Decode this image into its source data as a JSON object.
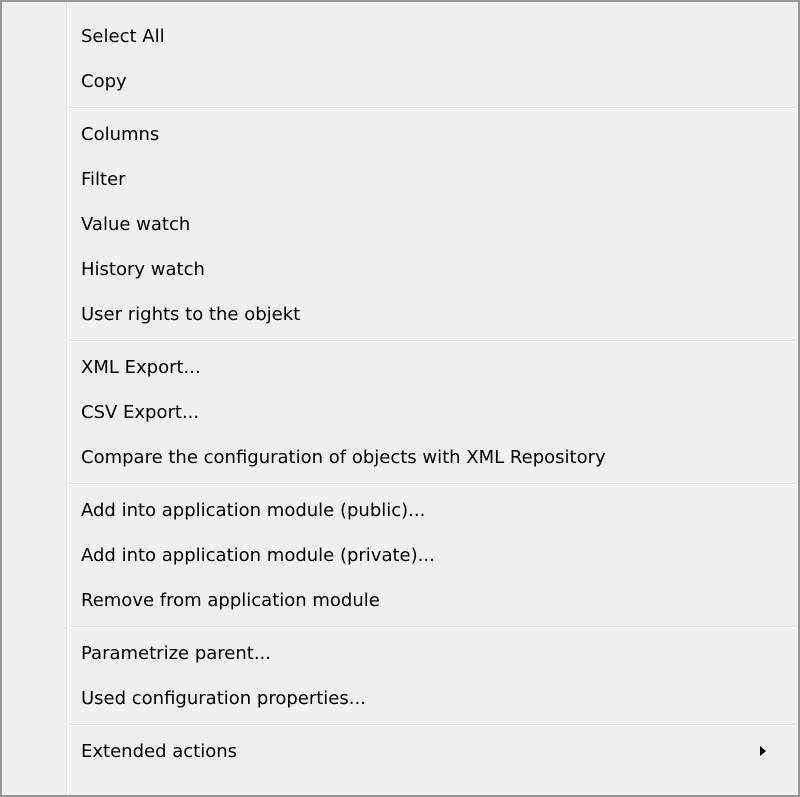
{
  "menu": {
    "groups": [
      [
        "Select All",
        "Copy"
      ],
      [
        "Columns",
        "Filter",
        "Value watch",
        "History watch",
        "User rights to the objekt"
      ],
      [
        "XML Export...",
        "CSV Export...",
        "Compare the configuration of objects with XML Repository"
      ],
      [
        "Add into application module (public)...",
        "Add into application module (private)...",
        "Remove from application module"
      ],
      [
        "Parametrize parent...",
        "Used configuration properties..."
      ],
      [
        "Extended actions"
      ]
    ],
    "submenu_icon": "submenu-arrow-icon"
  }
}
